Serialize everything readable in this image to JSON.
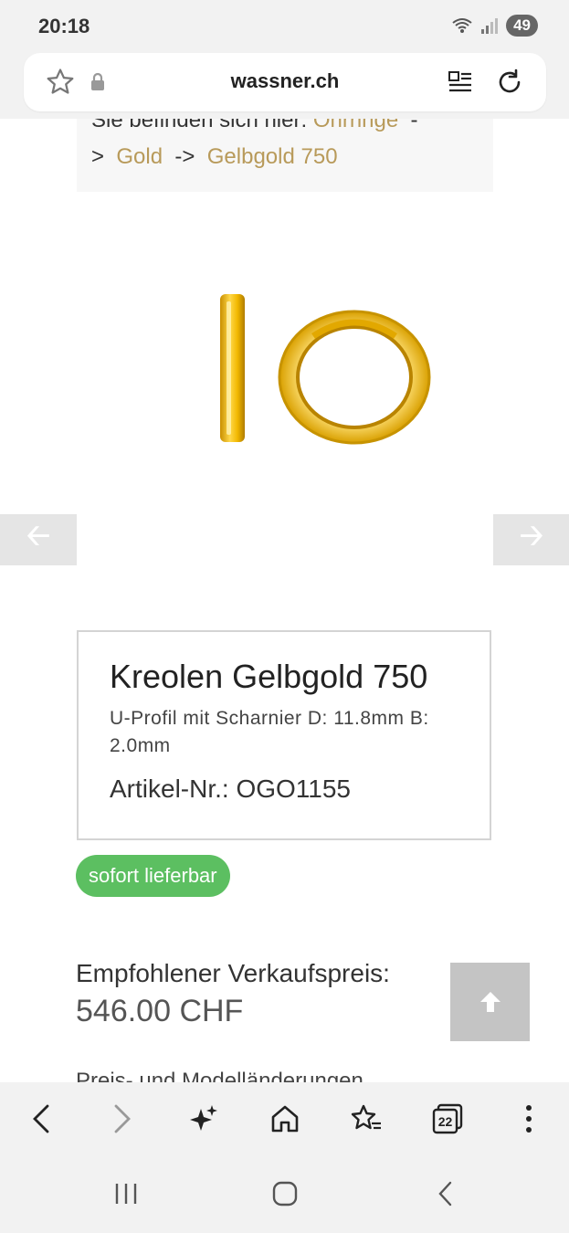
{
  "status": {
    "time": "20:18",
    "battery": "49"
  },
  "browser": {
    "url": "wassner.ch",
    "icons": {
      "favorite": "star-icon",
      "secure": "lock-icon",
      "reader": "reader-mode-icon",
      "reload": "reload-icon"
    }
  },
  "breadcrumb": {
    "prefix": "Sie befinden sich hier: ",
    "items": [
      "Ohrringe",
      "Gold",
      "Gelbgold 750"
    ],
    "separator": "->"
  },
  "gallery": {
    "prev_icon": "arrow-left-icon",
    "next_icon": "arrow-right-icon"
  },
  "product": {
    "title": "Kreolen Gelbgold 750",
    "subtitle": "U-Profil mit Scharnier D: 11.8mm B: 2.0mm",
    "article": "Artikel-Nr.: OGO1155",
    "availability": "sofort lieferbar",
    "price_label": "Empfohlener Verkaufspreis:",
    "price": "546.00 CHF",
    "note_cut": "Preis- und Modelländerungen"
  },
  "toolbar": {
    "tabs_count": "22",
    "icons": [
      "back-icon",
      "forward-icon",
      "sparkle-icon",
      "home-icon",
      "bookmarks-icon",
      "tabs-icon",
      "more-icon"
    ]
  },
  "colors": {
    "accent_gold": "#b89a5a",
    "badge_green": "#5cbf61",
    "gold_metal": "#e8b820"
  }
}
